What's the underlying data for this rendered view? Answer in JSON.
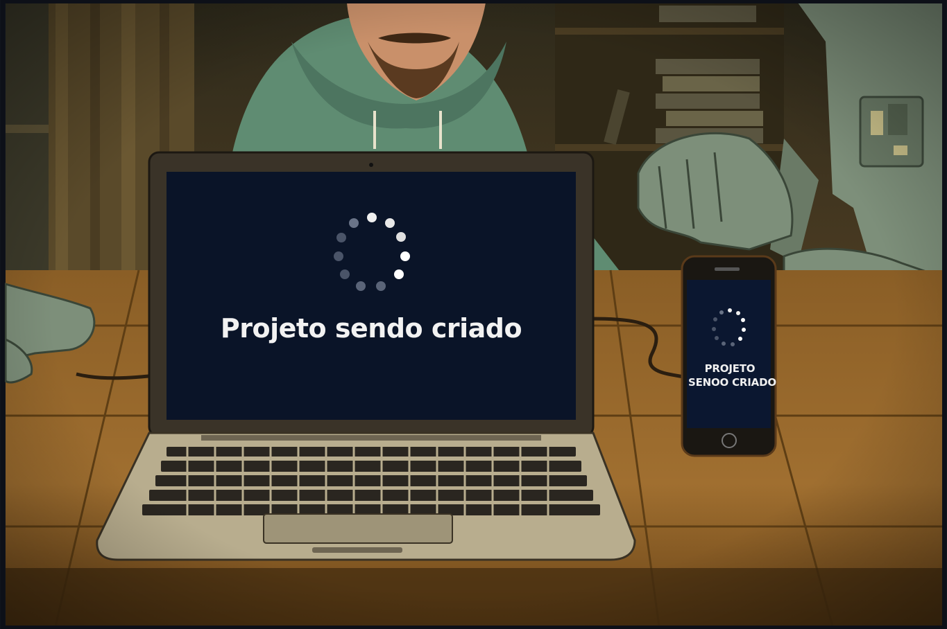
{
  "laptop": {
    "status_text": "Projeto sendo criado",
    "screen_color": "#0a1428"
  },
  "phone": {
    "status_line_1": "PROJETO",
    "status_line_2": "SENOO CRIADO",
    "screen_color": "#0b1730"
  },
  "colors": {
    "table_wood": "#9a6a2c",
    "wall_dark": "#3b2f1d",
    "hoodie": "#5f8c72",
    "robot_metal": "#7d8f7a"
  },
  "icons": {
    "laptop_spinner": "loading-spinner-icon",
    "phone_spinner": "loading-spinner-icon",
    "phone_home": "home-button-icon"
  }
}
